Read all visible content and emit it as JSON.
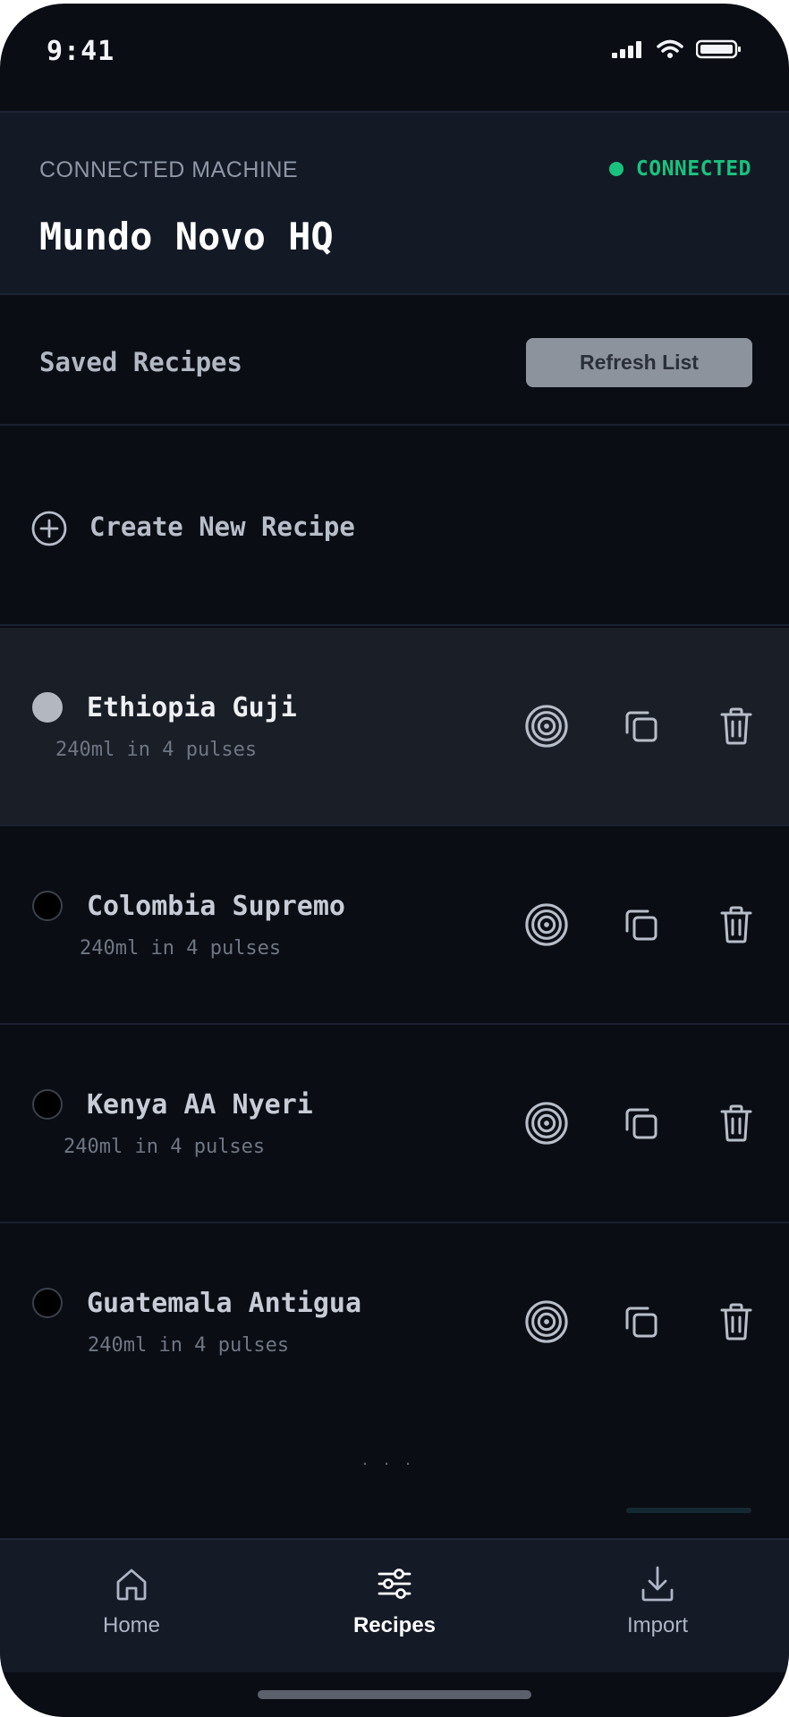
{
  "status_bar": {
    "time": "9:41"
  },
  "machine": {
    "label": "CONNECTED MACHINE",
    "status": "CONNECTED",
    "name": "Mundo Novo HQ",
    "status_color": "#19c37d"
  },
  "recipes_section": {
    "title": "Saved Recipes",
    "refresh_label": "Refresh List",
    "create_label": "Create New Recipe"
  },
  "recipes": [
    {
      "name": "Ethiopia Guji",
      "meta": "240ml in 4 pulses",
      "selected": true
    },
    {
      "name": "Colombia Supremo",
      "meta": "240ml in 4 pulses",
      "selected": false
    },
    {
      "name": "Kenya AA Nyeri",
      "meta": "240ml in 4 pulses",
      "selected": false
    },
    {
      "name": "Guatemala Antigua",
      "meta": "240ml in 4 pulses",
      "selected": false
    }
  ],
  "recipe_actions": {
    "icons": [
      "target-icon",
      "copy-icon",
      "trash-icon"
    ]
  },
  "pagination": "...",
  "tabs": [
    {
      "label": "Home",
      "icon": "home-icon",
      "active": false
    },
    {
      "label": "Recipes",
      "icon": "sliders-icon",
      "active": true
    },
    {
      "label": "Import",
      "icon": "download-icon",
      "active": false
    }
  ]
}
